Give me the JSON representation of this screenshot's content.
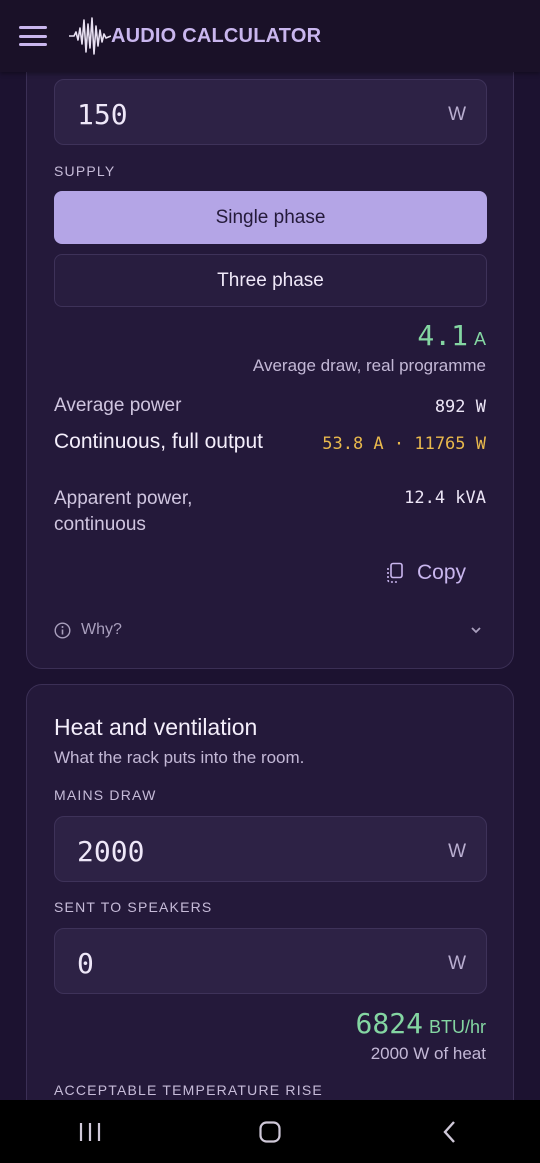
{
  "app": {
    "title": "AUDIO CALCULATOR"
  },
  "icons": {
    "menu": "hamburger-menu-icon",
    "logo": "waveform-icon",
    "copy": "copy-icon",
    "info": "info-icon",
    "chevron": "chevron-down-icon"
  },
  "colors": {
    "accent": "#b4a5e6",
    "result": "#84d6a2",
    "warning": "#e8b84c",
    "card": "#24193a",
    "background": "#1c1230"
  },
  "power_card": {
    "power_field": {
      "value": "150",
      "unit": "W"
    },
    "supply_label": "SUPPLY",
    "supply_options": [
      {
        "label": "Single phase",
        "selected": true
      },
      {
        "label": "Three phase",
        "selected": false
      }
    ],
    "result": {
      "value": "4.1",
      "unit": "A",
      "caption": "Average draw, real programme"
    },
    "rows": [
      {
        "label": "Average power",
        "value": "892 W"
      },
      {
        "label": "Continuous, full output",
        "value": "53.8 A · 11765 W"
      },
      {
        "label": "Apparent power, continuous",
        "value": "12.4 kVA"
      }
    ],
    "copy_label": "Copy",
    "why_label": "Why?"
  },
  "heat_card": {
    "title": "Heat and ventilation",
    "subtitle": "What the rack puts into the room.",
    "mains_label": "MAINS DRAW",
    "mains_field": {
      "value": "2000",
      "unit": "W"
    },
    "speakers_label": "SENT TO SPEAKERS",
    "speakers_field": {
      "value": "0",
      "unit": "W"
    },
    "result": {
      "value": "6824",
      "unit": "BTU/hr",
      "caption": "2000 W of heat"
    },
    "temp_label": "ACCEPTABLE TEMPERATURE RISE"
  },
  "navbar": {
    "items": [
      "recent-apps-icon",
      "home-icon",
      "back-icon"
    ]
  }
}
